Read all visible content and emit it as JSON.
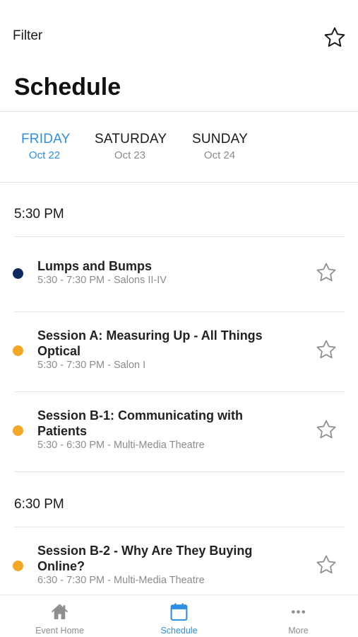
{
  "header": {
    "filter_label": "Filter",
    "title": "Schedule",
    "favorite_icon": "star-outline-icon"
  },
  "days": [
    {
      "name": "FRIDAY",
      "date": "Oct 22",
      "active": true
    },
    {
      "name": "SATURDAY",
      "date": "Oct 23",
      "active": false
    },
    {
      "name": "SUNDAY",
      "date": "Oct 24",
      "active": false
    }
  ],
  "schedule": {
    "groups": [
      {
        "time": "5:30 PM",
        "sessions": [
          {
            "title": "Lumps and Bumps",
            "meta": "5:30 - 7:30 PM - Salons II-IV",
            "color": "#0d2b5e"
          },
          {
            "title": "Session A: Measuring Up - All Things Optical",
            "meta": "5:30 - 7:30 PM - Salon I",
            "color": "#f2a826"
          },
          {
            "title": "Session B-1: Communicating with Patients",
            "meta": "5:30 - 6:30 PM - Multi-Media Theatre",
            "color": "#f2a826"
          }
        ]
      },
      {
        "time": "6:30 PM",
        "sessions": [
          {
            "title": "Session B-2 - Why Are They Buying Online?",
            "meta": "6:30 - 7:30 PM - Multi-Media Theatre",
            "color": "#f2a826"
          }
        ]
      }
    ]
  },
  "tabbar": {
    "items": [
      {
        "label": "Event Home",
        "icon": "home-icon",
        "active": false
      },
      {
        "label": "Schedule",
        "icon": "calendar-icon",
        "active": true
      },
      {
        "label": "More",
        "icon": "more-dots-icon",
        "active": false
      }
    ]
  },
  "colors": {
    "accent": "#2f8fe0",
    "navy_track": "#0d2b5e",
    "orange_track": "#f2a826",
    "muted_text": "#8c8c8c"
  }
}
